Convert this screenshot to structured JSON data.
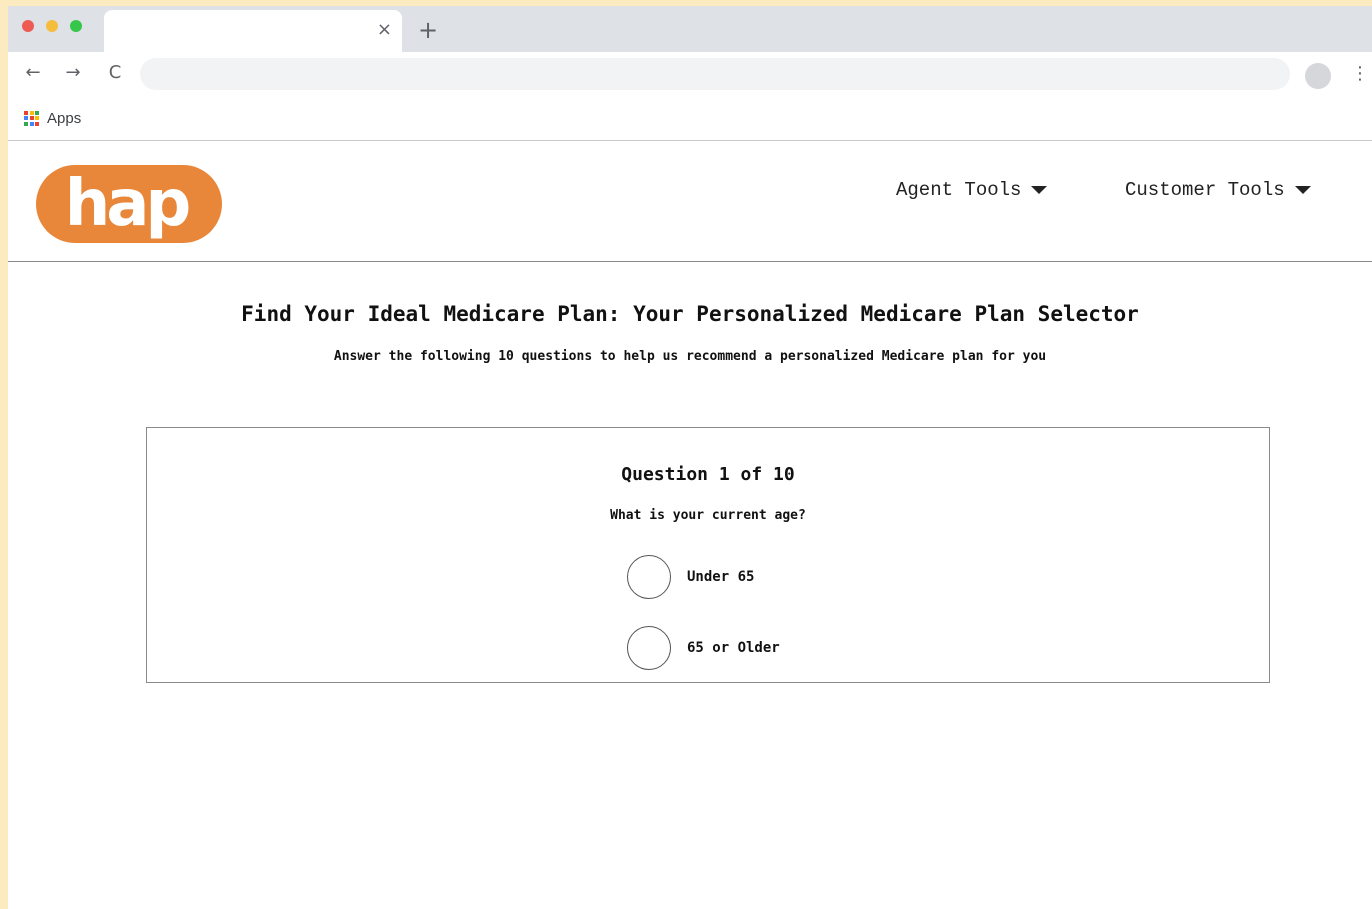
{
  "browser": {
    "tab_title": "",
    "tab_close": "×",
    "new_tab": "+",
    "address": "",
    "back": "←",
    "forward": "→",
    "reload": "C",
    "menu": "⋮",
    "bookmarks": {
      "apps_label": "Apps"
    }
  },
  "site": {
    "logo_text": "hap",
    "brand_color": "#e8873a",
    "nav": [
      {
        "label": "Agent Tools",
        "icon": "caret-down-icon"
      },
      {
        "label": "Customer Tools",
        "icon": "caret-down-icon"
      }
    ]
  },
  "main": {
    "title": "Find Your Ideal Medicare Plan: Your Personalized Medicare Plan Selector",
    "subtitle": "Answer the following 10 questions to help us recommend a personalized Medicare plan for you",
    "question": {
      "counter": "Question 1 of 10",
      "text": "What is your current age?",
      "options": [
        "Under 65",
        "65 or Older"
      ],
      "selected": null
    }
  }
}
